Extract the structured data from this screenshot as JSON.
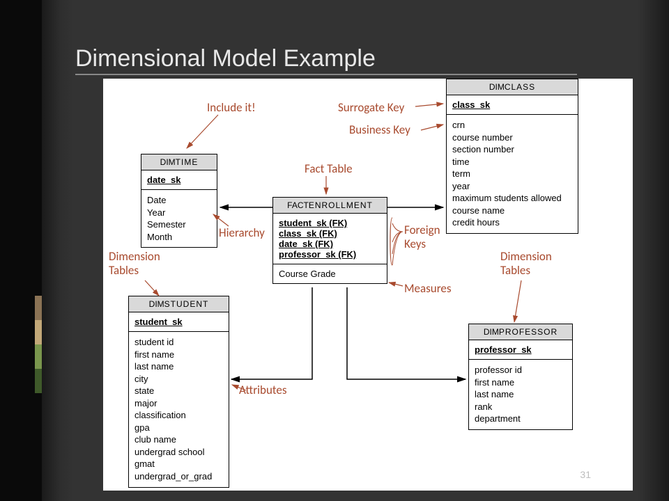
{
  "title": "Dimensional Model Example",
  "page_number": "31",
  "entities": {
    "time": {
      "prefix": "DIM",
      "name": "TIME",
      "pk": "date_sk",
      "attrs": [
        "Date",
        "Year",
        "Semester",
        "Month"
      ]
    },
    "class": {
      "prefix": "DIM",
      "name": "CLASS",
      "pk": "class_sk",
      "attrs": [
        "crn",
        "course number",
        "section number",
        "time",
        "term",
        "year",
        "maximum students allowed",
        "course name",
        "credit hours"
      ]
    },
    "student": {
      "prefix": "DIM",
      "name": "STUDENT",
      "pk": "student_sk",
      "attrs": [
        "student id",
        "first name",
        "last name",
        "city",
        "state",
        "major",
        "classification",
        "gpa",
        "club name",
        "undergrad school",
        "gmat",
        "undergrad_or_grad"
      ]
    },
    "professor": {
      "prefix": "DIM",
      "name": "PROFESSOR",
      "pk": "professor_sk",
      "attrs": [
        "professor id",
        "first name",
        "last name",
        "rank",
        "department"
      ]
    },
    "enrollment": {
      "prefix": "FACT",
      "name": "ENROLLMENT",
      "fks": [
        "student_sk (FK)",
        "class_sk (FK)",
        "date_sk (FK)",
        "professor_sk (FK)"
      ],
      "measure": "Course Grade"
    }
  },
  "annotations": {
    "include_it": "Include it!",
    "surrogate_key": "Surrogate Key",
    "business_key": "Business Key",
    "fact_table": "Fact Table",
    "hierarchy": "Hierarchy",
    "dimension_tables_left": "Dimension\nTables",
    "dimension_tables_right": "Dimension\nTables",
    "foreign_keys": "Foreign\nKeys",
    "measures": "Measures",
    "attributes": "Attributes"
  }
}
